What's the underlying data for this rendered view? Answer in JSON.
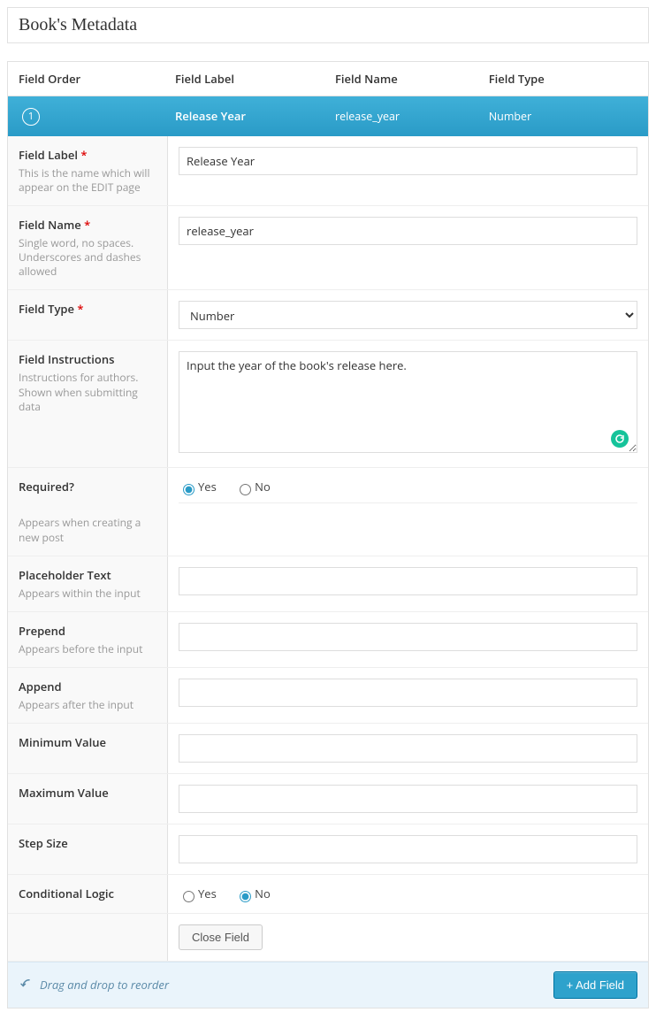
{
  "panel": {
    "title": "Book's Metadata"
  },
  "headers": {
    "order": "Field Order",
    "label": "Field Label",
    "name": "Field Name",
    "type": "Field Type"
  },
  "row": {
    "order": "1",
    "label": "Release Year",
    "name": "release_year",
    "type": "Number"
  },
  "settings": {
    "field_label": {
      "label": "Field Label",
      "required_mark": "*",
      "desc": "This is the name which will appear on the EDIT page",
      "value": "Release Year"
    },
    "field_name": {
      "label": "Field Name",
      "required_mark": "*",
      "desc": "Single word, no spaces. Underscores and dashes allowed",
      "value": "release_year"
    },
    "field_type": {
      "label": "Field Type",
      "required_mark": "*",
      "value": "Number"
    },
    "instructions": {
      "label": "Field Instructions",
      "desc": "Instructions for authors. Shown when submitting data",
      "value": "Input the year of the book's release here."
    },
    "required": {
      "label": "Required?",
      "desc": "Appears when creating a new post",
      "yes": "Yes",
      "no": "No",
      "value": "yes"
    },
    "placeholder": {
      "label": "Placeholder Text",
      "desc": "Appears within the input",
      "value": ""
    },
    "prepend": {
      "label": "Prepend",
      "desc": "Appears before the input",
      "value": ""
    },
    "append": {
      "label": "Append",
      "desc": "Appears after the input",
      "value": ""
    },
    "min": {
      "label": "Minimum Value",
      "value": ""
    },
    "max": {
      "label": "Maximum Value",
      "value": ""
    },
    "step": {
      "label": "Step Size",
      "value": ""
    },
    "conditional": {
      "label": "Conditional Logic",
      "yes": "Yes",
      "no": "No",
      "value": "no"
    }
  },
  "buttons": {
    "close": "Close Field",
    "add": "+ Add Field"
  },
  "footer": {
    "hint": "Drag and drop to reorder"
  }
}
